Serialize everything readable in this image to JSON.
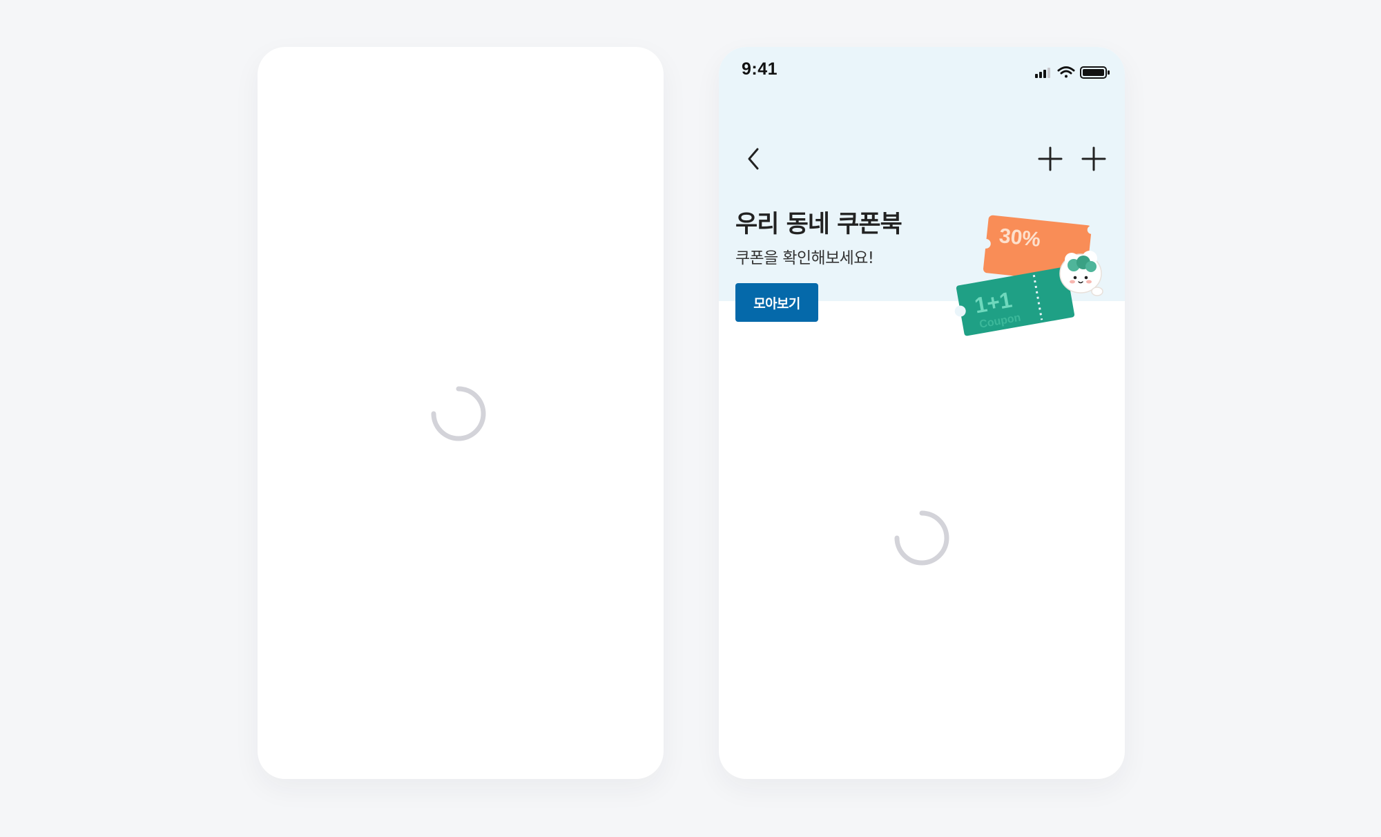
{
  "left_screen": {
    "state": "loading"
  },
  "right_screen": {
    "status_bar": {
      "time": "9:41",
      "icons": [
        "cellular-signal-icon",
        "wifi-icon",
        "battery-icon"
      ]
    },
    "nav": {
      "back_icon": "chevron-left-icon",
      "action_icons": [
        "plus-icon",
        "plus-icon"
      ]
    },
    "hero": {
      "title": "우리 동네 쿠폰북",
      "subtitle": "쿠폰을 확인해보세요!",
      "button_label": "모아보기",
      "coupon_orange_text": "30%",
      "coupon_green_text": "1+1",
      "coupon_green_subtext": "Coupon"
    },
    "content": {
      "state": "loading"
    }
  },
  "colors": {
    "page_background": "#f5f6f8",
    "hero_background": "#eaf5fa",
    "primary_button": "#0569aa",
    "spinner": "#d3d3d9",
    "coupon_orange": "#f98d57",
    "coupon_green": "#1fa085"
  }
}
